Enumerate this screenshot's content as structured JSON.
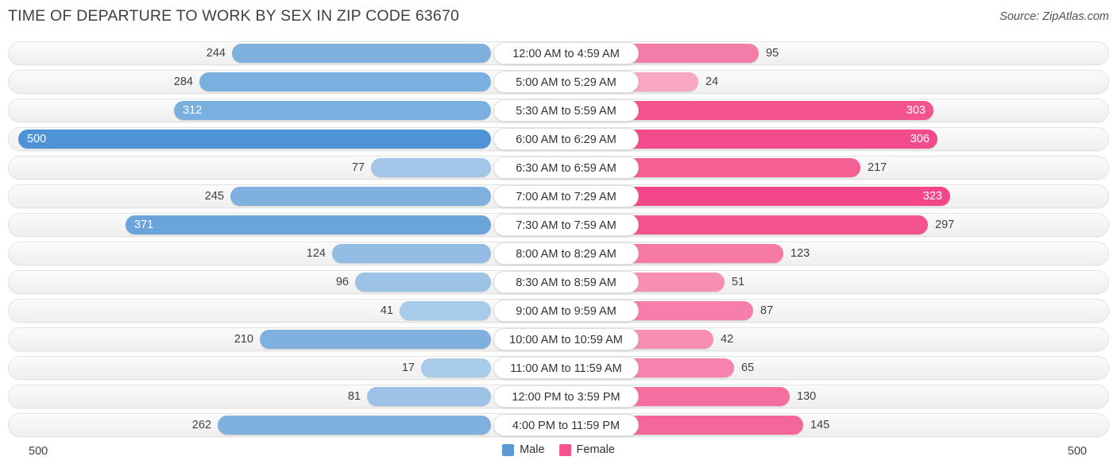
{
  "header": {
    "title": "TIME OF DEPARTURE TO WORK BY SEX IN ZIP CODE 63670",
    "source": "Source: ZipAtlas.com"
  },
  "legend": {
    "male_label": "Male",
    "female_label": "Female",
    "male_color": "#5b9bd5",
    "female_color": "#f4538f"
  },
  "axis": {
    "left": "500",
    "right": "500"
  },
  "chart_data": {
    "type": "bar",
    "title": "TIME OF DEPARTURE TO WORK BY SEX IN ZIP CODE 63670",
    "subtitle": "Source: ZipAtlas.com",
    "orientation": "horizontal-diverging",
    "xlabel": "",
    "ylabel": "",
    "axis_min_label": "500",
    "axis_max_label": "500",
    "grid": false,
    "legend_position": "bottom-center",
    "categories": [
      "12:00 AM to 4:59 AM",
      "5:00 AM to 5:29 AM",
      "5:30 AM to 5:59 AM",
      "6:00 AM to 6:29 AM",
      "6:30 AM to 6:59 AM",
      "7:00 AM to 7:29 AM",
      "7:30 AM to 7:59 AM",
      "8:00 AM to 8:29 AM",
      "8:30 AM to 8:59 AM",
      "9:00 AM to 9:59 AM",
      "10:00 AM to 10:59 AM",
      "11:00 AM to 11:59 AM",
      "12:00 PM to 3:59 PM",
      "4:00 PM to 11:59 PM"
    ],
    "series": [
      {
        "name": "Male",
        "color": "#5b9bd5",
        "values": [
          244,
          284,
          312,
          500,
          77,
          245,
          371,
          124,
          96,
          41,
          210,
          17,
          81,
          262
        ]
      },
      {
        "name": "Female",
        "color": "#f4538f",
        "values": [
          95,
          24,
          303,
          306,
          217,
          323,
          297,
          123,
          51,
          87,
          42,
          65,
          130,
          145
        ]
      }
    ]
  },
  "rows": [
    {
      "label": "12:00 AM to 4:59 AM",
      "male": {
        "value": "244",
        "start": 292,
        "color": "#7fb0de",
        "inside": false
      },
      "female": {
        "value": "95",
        "end": 955,
        "color": "#f47ca8",
        "inside": false
      }
    },
    {
      "label": "5:00 AM to 5:29 AM",
      "male": {
        "value": "284",
        "start": 251,
        "color": "#7ab0e0",
        "inside": false
      },
      "female": {
        "value": "24",
        "end": 879,
        "color": "#f9a6c4",
        "inside": false
      }
    },
    {
      "label": "5:30 AM to 5:59 AM",
      "male": {
        "value": "312",
        "start": 219,
        "color": "#7ab0e0",
        "inside": true
      },
      "female": {
        "value": "303",
        "end": 1175,
        "color": "#f4538f",
        "inside": true
      }
    },
    {
      "label": "6:00 AM to 6:29 AM",
      "male": {
        "value": "500",
        "start": 23,
        "color": "#4e93d5",
        "inside": true
      },
      "female": {
        "value": "306",
        "end": 1180,
        "color": "#f24b8b",
        "inside": true
      }
    },
    {
      "label": "6:30 AM to 6:59 AM",
      "male": {
        "value": "77",
        "start": 467,
        "color": "#a3c6e8",
        "inside": false
      },
      "female": {
        "value": "217",
        "end": 1083,
        "color": "#f45f94",
        "inside": false
      }
    },
    {
      "label": "7:00 AM to 7:29 AM",
      "male": {
        "value": "245",
        "start": 290,
        "color": "#7fb0de",
        "inside": false
      },
      "female": {
        "value": "323",
        "end": 1196,
        "color": "#f3478a",
        "inside": true
      }
    },
    {
      "label": "7:30 AM to 7:59 AM",
      "male": {
        "value": "371",
        "start": 158,
        "color": "#6ba4da",
        "inside": true
      },
      "female": {
        "value": "297",
        "end": 1168,
        "color": "#f4538f",
        "inside": false
      }
    },
    {
      "label": "8:00 AM to 8:29 AM",
      "male": {
        "value": "124",
        "start": 418,
        "color": "#93bde4",
        "inside": false
      },
      "female": {
        "value": "123",
        "end": 986,
        "color": "#f77aa6",
        "inside": false
      }
    },
    {
      "label": "8:30 AM to 8:59 AM",
      "male": {
        "value": "96",
        "start": 447,
        "color": "#9cc2e6",
        "inside": false
      },
      "female": {
        "value": "51",
        "end": 912,
        "color": "#f78fb4",
        "inside": false
      }
    },
    {
      "label": "9:00 AM to 9:59 AM",
      "male": {
        "value": "41",
        "start": 503,
        "color": "#a8cbea",
        "inside": false
      },
      "female": {
        "value": "87",
        "end": 948,
        "color": "#f77daa",
        "inside": false
      }
    },
    {
      "label": "10:00 AM to 10:59 AM",
      "male": {
        "value": "210",
        "start": 327,
        "color": "#7fb0de",
        "inside": false
      },
      "female": {
        "value": "42",
        "end": 898,
        "color": "#f78fb4",
        "inside": false
      }
    },
    {
      "label": "11:00 AM to 11:59 AM",
      "male": {
        "value": "17",
        "start": 530,
        "color": "#a8cbea",
        "inside": false
      },
      "female": {
        "value": "65",
        "end": 924,
        "color": "#f782ad",
        "inside": false
      }
    },
    {
      "label": "12:00 PM to 3:59 PM",
      "male": {
        "value": "81",
        "start": 462,
        "color": "#9cc2e6",
        "inside": false
      },
      "female": {
        "value": "130",
        "end": 994,
        "color": "#f66ea0",
        "inside": false
      }
    },
    {
      "label": "4:00 PM to 11:59 PM",
      "male": {
        "value": "262",
        "start": 274,
        "color": "#7fb0de",
        "inside": false
      },
      "female": {
        "value": "145",
        "end": 1011,
        "color": "#f4679b",
        "inside": false
      }
    }
  ]
}
